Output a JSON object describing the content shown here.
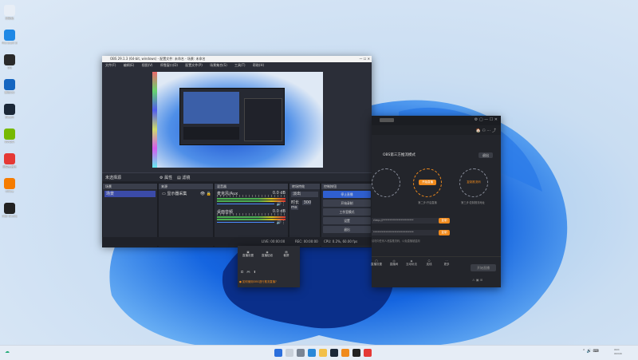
{
  "desktop_icons": [
    {
      "label": "回收站",
      "color": "#e8eef6"
    },
    {
      "label": "Microsoft Edge",
      "color": "#1e88e5"
    },
    {
      "label": "QQ",
      "color": "#2a2a2a"
    },
    {
      "label": "腾讯QQ",
      "color": "#1565c0"
    },
    {
      "label": "Steam",
      "color": "#1b2838"
    },
    {
      "label": "NVIDIA",
      "color": "#76b900"
    },
    {
      "label": "网易云音乐",
      "color": "#e53935"
    },
    {
      "label": "Office",
      "color": "#f57c00"
    },
    {
      "label": "OBS Studio",
      "color": "#222"
    }
  ],
  "obs": {
    "title": "OBS 29.1.3 (64-bit, windows) - 配置文件: 未命名 - 场景: 未命名",
    "menu": [
      "文件(F)",
      "编辑(E)",
      "视图(V)",
      "停靠窗口(D)",
      "配置文件(P)",
      "场景集合(S)",
      "工具(T)",
      "帮助(H)"
    ],
    "source_bar": {
      "label": "未选择源",
      "props": "属性",
      "filters": "滤镜"
    },
    "scenes": {
      "header": "场景",
      "items": [
        "场景"
      ]
    },
    "sources": {
      "header": "来源",
      "items": [
        "显示器采集"
      ]
    },
    "mixer": {
      "header": "混音器",
      "tracks": [
        {
          "name": "麦克风/Aux",
          "db": "0.0 dB"
        },
        {
          "name": "桌面音频",
          "db": "0.0 dB"
        }
      ]
    },
    "transitions": {
      "header": "转场特效",
      "type": "淡出",
      "duration_label": "时长",
      "duration": "300 ms"
    },
    "controls": {
      "header": "控制按钮",
      "buttons": [
        "停止直播",
        "开始录制",
        "工作室模式",
        "设置",
        "退出"
      ]
    },
    "status": {
      "live": "LIVE: 00:00:00",
      "rec": "REC: 00:00:00",
      "cpu": "CPU: 0.2%, 60.00 fps"
    }
  },
  "live_app": {
    "title_btn": "",
    "mode_title": "OBS第三方推流模式",
    "mode_action": "退出",
    "steps": [
      {
        "label": "开始直播",
        "desc": "第二步:开启直播"
      },
      {
        "label": "复制推流码",
        "desc": "第三步:复制推流地址"
      }
    ],
    "fields": [
      {
        "value": "rtmp://**********************",
        "btn": "复制"
      },
      {
        "value": "*****************************",
        "btn": "复制"
      }
    ],
    "hint": "请勿向任何人泄露推流码，以免直播被盗用",
    "toolbar": [
      "直播设置",
      "直播间",
      "互动玩法",
      "连线",
      "更多"
    ],
    "bottom_btn": "开始直播"
  },
  "side_panel": {
    "buttons": [
      "直播设置",
      "直播贴纸",
      "截屏"
    ],
    "warning": "如何使用OBS进行推流直播?"
  }
}
